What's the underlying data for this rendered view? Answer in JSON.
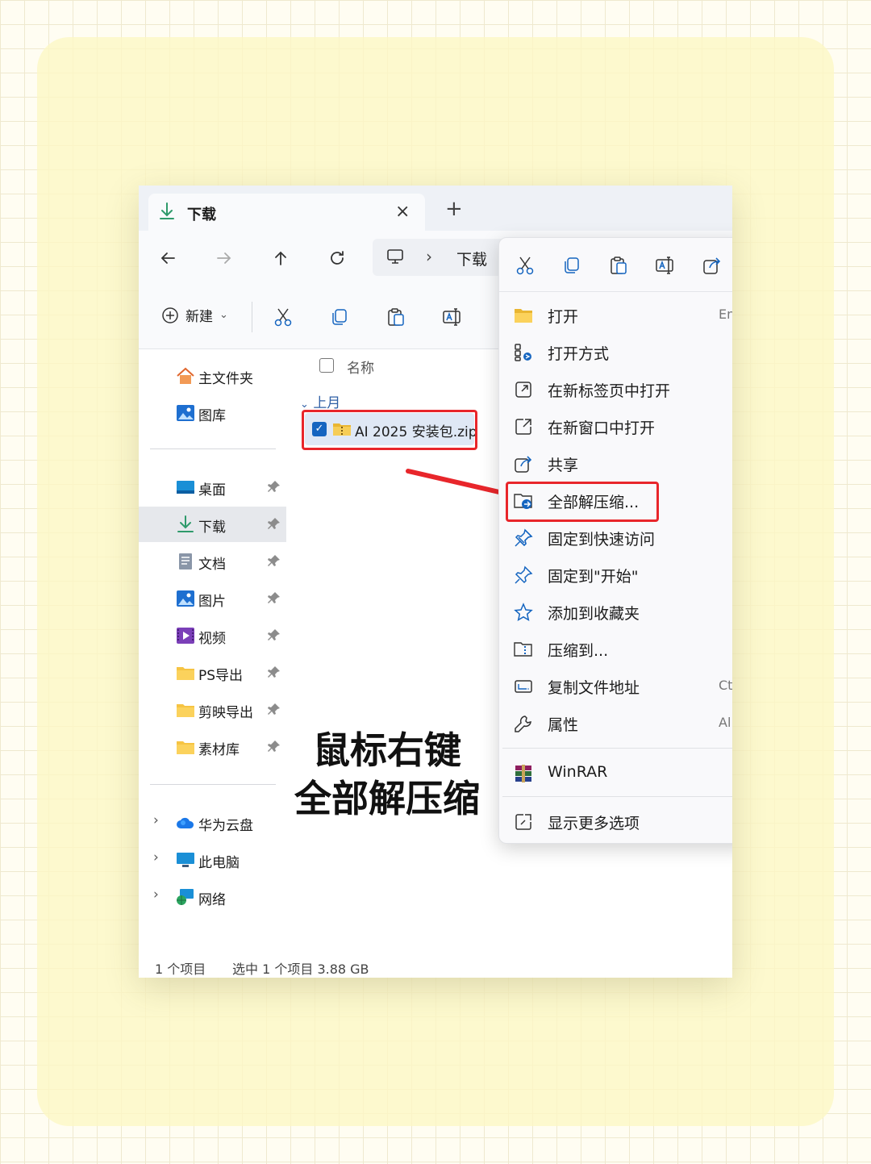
{
  "tab": {
    "title": "下载",
    "close_glyph": "×",
    "new_tab_glyph": "+"
  },
  "address": {
    "separator": "›",
    "current": "下载"
  },
  "commandbar": {
    "new_label": "新建",
    "new_chevron": "⌄"
  },
  "sidebar": {
    "pinned_top": [
      {
        "label": "主文件夹",
        "icon": "home-icon"
      },
      {
        "label": "图库",
        "icon": "gallery-icon"
      }
    ],
    "quick_access": [
      {
        "label": "桌面",
        "icon": "desktop-icon",
        "pinned": true,
        "selected": false
      },
      {
        "label": "下载",
        "icon": "download-icon",
        "pinned": true,
        "selected": true
      },
      {
        "label": "文档",
        "icon": "document-icon",
        "pinned": true,
        "selected": false
      },
      {
        "label": "图片",
        "icon": "pictures-icon",
        "pinned": true,
        "selected": false
      },
      {
        "label": "视频",
        "icon": "videos-icon",
        "pinned": true,
        "selected": false
      },
      {
        "label": "PS导出",
        "icon": "folder-icon",
        "pinned": true,
        "selected": false
      },
      {
        "label": "剪映导出",
        "icon": "folder-icon",
        "pinned": true,
        "selected": false
      },
      {
        "label": "素材库",
        "icon": "folder-icon",
        "pinned": true,
        "selected": false
      }
    ],
    "locations": [
      {
        "label": "华为云盘",
        "icon": "cloud-icon",
        "chevron": "›"
      },
      {
        "label": "此电脑",
        "icon": "computer-icon",
        "chevron": "›"
      },
      {
        "label": "网络",
        "icon": "network-icon",
        "chevron": "›"
      }
    ]
  },
  "files": {
    "column_name": "名称",
    "group_label": "上月",
    "group_chevron": "⌄",
    "rows": [
      {
        "name": "AI 2025 安装包.zip",
        "checked": true,
        "check_glyph": "✓"
      }
    ]
  },
  "caption": {
    "line1": "鼠标右键",
    "line2": "全部解压缩"
  },
  "status": {
    "count": "1 个项目",
    "selection": "选中 1 个项目  3.88 GB"
  },
  "context_menu": {
    "items": [
      {
        "label": "打开",
        "icon": "folder-open-icon",
        "shortcut": "En",
        "highlighted": false
      },
      {
        "label": "打开方式",
        "icon": "open-with-icon",
        "shortcut": "",
        "highlighted": false
      },
      {
        "label": "在新标签页中打开",
        "icon": "new-tab-icon",
        "shortcut": "",
        "highlighted": false
      },
      {
        "label": "在新窗口中打开",
        "icon": "new-window-icon",
        "shortcut": "",
        "highlighted": false
      },
      {
        "label": "共享",
        "icon": "share-icon",
        "shortcut": "",
        "highlighted": false
      },
      {
        "label": "全部解压缩...",
        "icon": "extract-all-icon",
        "shortcut": "",
        "highlighted": true
      },
      {
        "label": "固定到快速访问",
        "icon": "pin-icon",
        "shortcut": "",
        "highlighted": false
      },
      {
        "label": "固定到\"开始\"",
        "icon": "pin-start-icon",
        "shortcut": "",
        "highlighted": false
      },
      {
        "label": "添加到收藏夹",
        "icon": "star-icon",
        "shortcut": "",
        "highlighted": false
      },
      {
        "label": "压缩到...",
        "icon": "compress-icon",
        "shortcut": "",
        "highlighted": false
      },
      {
        "label": "复制文件地址",
        "icon": "copy-path-icon",
        "shortcut": "Ct",
        "highlighted": false
      },
      {
        "label": "属性",
        "icon": "properties-icon",
        "shortcut": "Al",
        "highlighted": false
      }
    ],
    "winrar_label": "WinRAR",
    "more_label": "显示更多选项"
  },
  "colors": {
    "highlight_red": "#e8262b",
    "accent_blue": "#1565c0",
    "folder_yellow": "#f6c443"
  }
}
